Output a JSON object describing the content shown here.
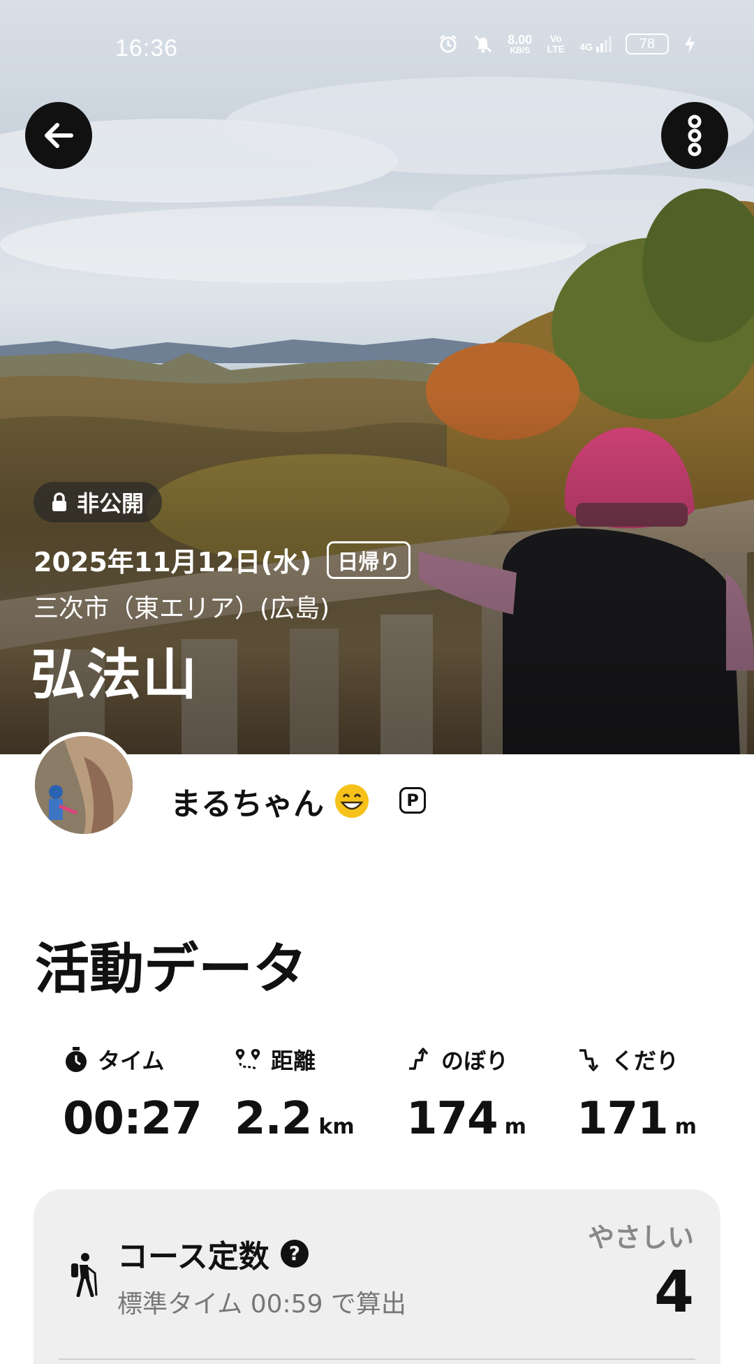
{
  "status_bar": {
    "time": "16:36",
    "speed_value": "8.00",
    "speed_unit": "KB/S",
    "volte": "Vo LTE",
    "network": "4G",
    "battery": "78"
  },
  "hero": {
    "privacy_label": "非公開",
    "date": "2025年11月12日(水)",
    "trip_type": "日帰り",
    "area": "三次市（東エリア）(広島)",
    "mountain": "弘法山"
  },
  "user": {
    "name": "まるちゃん",
    "badge": "P"
  },
  "activity": {
    "title": "活動データ",
    "stats": [
      {
        "label": "タイム",
        "value": "00:27",
        "unit": "",
        "icon": "stopwatch-icon"
      },
      {
        "label": "距離",
        "value": "2.2",
        "unit": "km",
        "icon": "route-icon"
      },
      {
        "label": "のぼり",
        "value": "174",
        "unit": "m",
        "icon": "ascent-icon"
      },
      {
        "label": "くだり",
        "value": "171",
        "unit": "m",
        "icon": "descent-icon"
      }
    ]
  },
  "course": {
    "title": "コース定数",
    "subtitle": "標準タイム 00:59 で算出",
    "level": "やさしい",
    "value": "4"
  },
  "colors": {
    "button_bg": "#111111",
    "card_bg": "#efefef",
    "hat_pink": "#d8457a"
  }
}
